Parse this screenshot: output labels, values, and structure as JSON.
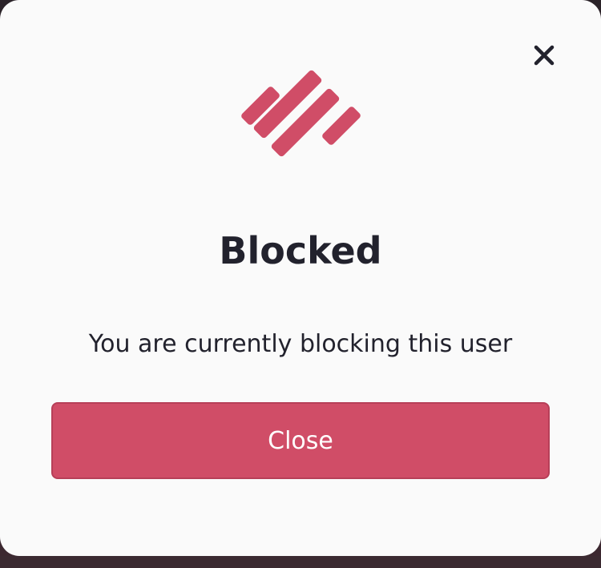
{
  "modal": {
    "title": "Blocked",
    "message": "You are currently blocking this user",
    "close_button_label": "Close",
    "close_icon": "close-icon",
    "logo_icon": "brand-logo-icon"
  },
  "colors": {
    "accent": "#d04d67",
    "text": "#22222d",
    "background": "#fafafa"
  }
}
